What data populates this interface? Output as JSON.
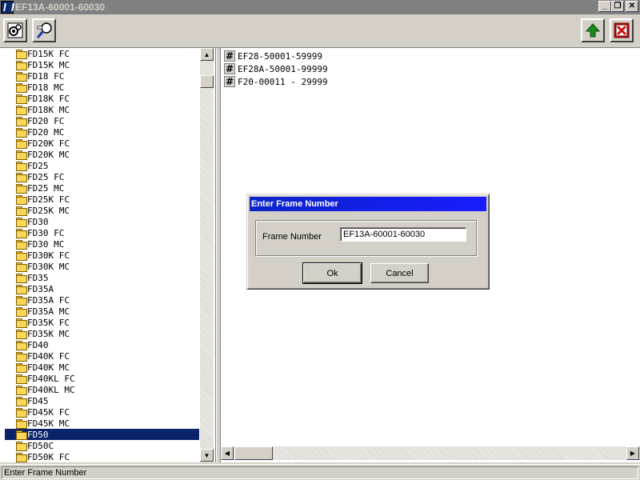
{
  "window": {
    "title": "EF13A-60001-60030",
    "controls": {
      "minimize": "_",
      "restore": "❐",
      "close": "✕"
    }
  },
  "toolbar": {
    "left_tools": [
      "settings-gear-icon",
      "search-magnifier-icon"
    ],
    "right_tools": [
      "up-arrow-icon",
      "exit-icon"
    ],
    "colors": {
      "up_arrow": "#1a8a1a",
      "exit": "#d01010"
    }
  },
  "tree": {
    "items": [
      "FD15K FC",
      "FD15K MC",
      "FD18 FC",
      "FD18 MC",
      "FD18K FC",
      "FD18K MC",
      "FD20 FC",
      "FD20 MC",
      "FD20K FC",
      "FD20K MC",
      "FD25",
      "FD25 FC",
      "FD25 MC",
      "FD25K FC",
      "FD25K MC",
      "FD30",
      "FD30 FC",
      "FD30 MC",
      "FD30K FC",
      "FD30K MC",
      "FD35",
      "FD35A",
      "FD35A FC",
      "FD35A MC",
      "FD35K FC",
      "FD35K MC",
      "FD40",
      "FD40K FC",
      "FD40K MC",
      "FD40KL FC",
      "FD40KL MC",
      "FD45",
      "FD45K FC",
      "FD45K MC",
      "FD50",
      "FD50C",
      "FD50K FC"
    ],
    "selected_index": 34
  },
  "frames": {
    "items": [
      "EF28-50001-59999",
      "EF28A-50001-99999",
      "F20-00011 - 29999"
    ],
    "icon_glyph": "#"
  },
  "dialog": {
    "title": "Enter Frame Number",
    "label": "Frame Number",
    "value": "EF13A-60001-60030",
    "ok_label": "Ok",
    "cancel_label": "Cancel"
  },
  "status": {
    "text": "Enter Frame Number"
  }
}
